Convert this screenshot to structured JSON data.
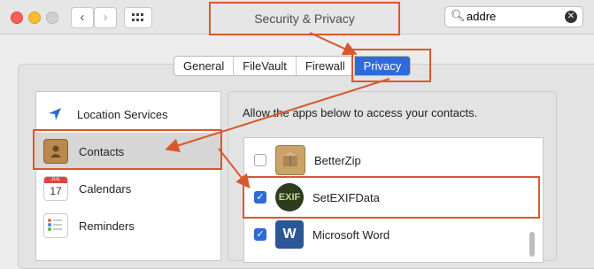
{
  "window": {
    "title": "Security & Privacy"
  },
  "search": {
    "value": "addre"
  },
  "tabs": [
    {
      "label": "General",
      "active": false
    },
    {
      "label": "FileVault",
      "active": false
    },
    {
      "label": "Firewall",
      "active": false
    },
    {
      "label": "Privacy",
      "active": true
    }
  ],
  "sidebar": {
    "items": [
      {
        "label": "Location Services",
        "icon": "location-icon"
      },
      {
        "label": "Contacts",
        "icon": "contacts-icon",
        "selected": true
      },
      {
        "label": "Calendars",
        "icon": "calendar-icon"
      },
      {
        "label": "Reminders",
        "icon": "reminders-icon"
      }
    ]
  },
  "calendar_icon": {
    "month": "JUL",
    "day": "17"
  },
  "main": {
    "description": "Allow the apps below to access your contacts.",
    "apps": [
      {
        "name": "BetterZip",
        "checked": false,
        "icon": "betterzip-icon"
      },
      {
        "name": "SetEXIFData",
        "checked": true,
        "icon": "setexifdata-icon"
      },
      {
        "name": "Microsoft Word",
        "checked": true,
        "icon": "word-icon"
      }
    ]
  },
  "app_icon_text": {
    "setexifdata": "EXIF",
    "word": "W"
  },
  "colors": {
    "accent": "#2f6bd8",
    "annotation": "#d9582b"
  }
}
